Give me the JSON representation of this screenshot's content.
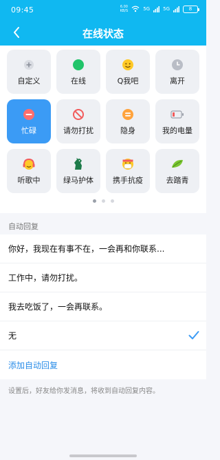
{
  "status_bar": {
    "time": "09:45",
    "net_speed_value": "6.00",
    "net_speed_unit": "KB/S",
    "wifi": "wifi-icon",
    "signal1": "5G",
    "signal2": "5G",
    "battery": "8"
  },
  "header": {
    "title": "在线状态",
    "back_icon": "back-arrow-icon",
    "bar_color": "#10b8f1"
  },
  "status_grid": [
    {
      "label": "自定义",
      "icon": "plus-icon",
      "selected": false
    },
    {
      "label": "在线",
      "icon": "green-dot-icon",
      "selected": false
    },
    {
      "label": "Q我吧",
      "icon": "smile-face-icon",
      "selected": false
    },
    {
      "label": "离开",
      "icon": "clock-icon",
      "selected": false
    },
    {
      "label": "忙碌",
      "icon": "minus-circle-icon",
      "selected": true
    },
    {
      "label": "请勿打扰",
      "icon": "no-entry-icon",
      "selected": false
    },
    {
      "label": "隐身",
      "icon": "equals-circle-icon",
      "selected": false
    },
    {
      "label": "我的电量",
      "icon": "battery-icon",
      "selected": false
    },
    {
      "label": "听歌中",
      "icon": "headphones-face-icon",
      "selected": false
    },
    {
      "label": "绿马护体",
      "icon": "green-horse-icon",
      "selected": false
    },
    {
      "label": "携手抗疫",
      "icon": "mask-face-icon",
      "selected": false
    },
    {
      "label": "去踏青",
      "icon": "leaf-icon",
      "selected": false
    }
  ],
  "pager": {
    "total": 3,
    "current": 1
  },
  "auto_reply": {
    "section_title": "自动回复",
    "options": [
      {
        "text": "你好，我现在有事不在，一会再和你联系...",
        "checked": false
      },
      {
        "text": "工作中，请勿打扰。",
        "checked": false
      },
      {
        "text": "我去吃饭了，一会再联系。",
        "checked": false
      },
      {
        "text": "无",
        "checked": true
      }
    ],
    "add_label": "添加自动回复",
    "footer_note": "设置后，好友给你发消息，将收到自动回复内容。"
  },
  "colors": {
    "accent": "#3b9bf5",
    "link": "#2a8de8"
  }
}
